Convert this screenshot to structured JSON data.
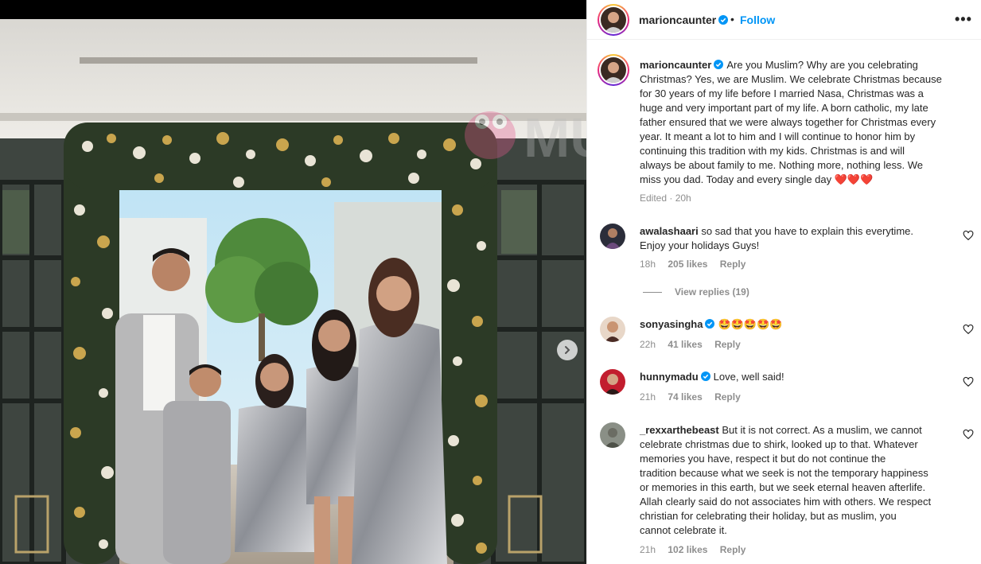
{
  "header": {
    "username": "marioncaunter",
    "separator": "•",
    "follow_label": "Follow",
    "more_label": "•••"
  },
  "caption": {
    "username": "marioncaunter",
    "lines": [
      "Are you Muslim? Why are you celebrating",
      "Christmas? Yes, we are Muslim. We celebrate Christmas because",
      "for 30 years of my life before I married Nasa, Christmas was a",
      "huge and very important part of my life. A born catholic, my late",
      "father ensured that we were always together for Christmas every",
      "year. It meant a lot to him and I will continue to honor him by",
      "continuing this tradition with my kids. Christmas is and will",
      "always be about family to me. Nothing more, nothing less. We",
      "miss you dad. Today and every single day"
    ],
    "emojis": "❤️❤️❤️",
    "meta": "Edited · 20h"
  },
  "comments": [
    {
      "username": "awalashaari",
      "verified": false,
      "lines": [
        "so sad that you have to explain this everytime.",
        "Enjoy your holidays Guys!"
      ],
      "time": "18h",
      "likes": "205 likes",
      "reply": "Reply",
      "view_replies": "View replies (19)"
    },
    {
      "username": "sonyasingha",
      "verified": true,
      "lines": [
        "🤩🤩🤩🤩🤩"
      ],
      "time": "22h",
      "likes": "41 likes",
      "reply": "Reply"
    },
    {
      "username": "hunnymadu",
      "verified": true,
      "lines": [
        "Love, well said!"
      ],
      "time": "21h",
      "likes": "74 likes",
      "reply": "Reply"
    },
    {
      "username": "_rexxarthebeast",
      "verified": false,
      "lines": [
        "But it is not correct. As a muslim, we cannot",
        "celebrate christmas due to shirk, looked up to that. Whatever",
        "memories you have, respect it but do not continue the",
        "tradition because what we seek is not the temporary happiness",
        "or memories in this earth, but we seek eternal heaven afterlife.",
        "Allah clearly said do not associates him with others. We respect",
        "christian for celebrating their holiday, but as muslim, you",
        "cannot celebrate it."
      ],
      "time": "21h",
      "likes": "102 likes",
      "reply": "Reply"
    }
  ],
  "watermark": "MU",
  "colors": {
    "accent": "#0095f6",
    "verified": "#0095f6",
    "muted": "#8e8e8e",
    "text": "#262626"
  },
  "icons": {
    "verified": "verified-badge-icon",
    "heart": "heart-outline-icon",
    "next": "chevron-right-icon"
  }
}
